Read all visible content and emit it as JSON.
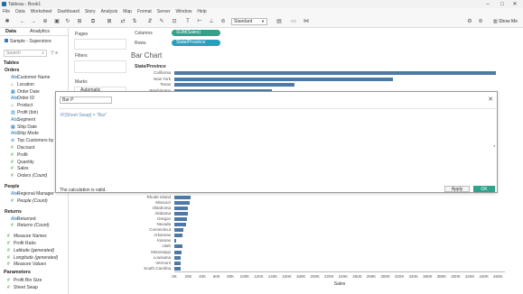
{
  "window": {
    "title": "Tableau - Book1"
  },
  "menu": [
    "File",
    "Data",
    "Worksheet",
    "Dashboard",
    "Story",
    "Analysis",
    "Map",
    "Format",
    "Server",
    "Window",
    "Help"
  ],
  "toolbar": {
    "mark_fit": "Standard",
    "show_me": "Show Me"
  },
  "left": {
    "tabs": [
      "Data",
      "Analytics"
    ],
    "datasource": "Sample - Superstore",
    "search_placeholder": "Search",
    "tables_header": "Tables",
    "groups": [
      {
        "name": "Orders",
        "items": [
          {
            "label": "Customer Name",
            "kind": "dim",
            "icon": "Abc"
          },
          {
            "label": "Location",
            "kind": "dim",
            "icon": "⌂"
          },
          {
            "label": "Order Date",
            "kind": "dim",
            "icon": "▦"
          },
          {
            "label": "Order ID",
            "kind": "dim",
            "icon": "Abc"
          },
          {
            "label": "Product",
            "kind": "dim",
            "icon": "⌂"
          },
          {
            "label": "Profit (bin)",
            "kind": "dim",
            "icon": "▥"
          },
          {
            "label": "Segment",
            "kind": "dim",
            "icon": "Abc"
          },
          {
            "label": "Ship Date",
            "kind": "dim",
            "icon": "▦"
          },
          {
            "label": "Ship Mode",
            "kind": "dim",
            "icon": "Abc"
          },
          {
            "label": "Top Customers by P...",
            "kind": "dim",
            "icon": "⊘"
          },
          {
            "label": "Discount",
            "kind": "mea",
            "icon": "#"
          },
          {
            "label": "Profit",
            "kind": "mea",
            "icon": "#"
          },
          {
            "label": "Quantity",
            "kind": "mea",
            "icon": "#"
          },
          {
            "label": "Sales",
            "kind": "mea",
            "icon": "#"
          },
          {
            "label": "Orders (Count)",
            "kind": "mea",
            "icon": "#",
            "italic": true
          }
        ]
      },
      {
        "name": "People",
        "items": [
          {
            "label": "Regional Manager",
            "kind": "dim",
            "icon": "Abc"
          },
          {
            "label": "People (Count)",
            "kind": "mea",
            "icon": "#",
            "italic": true
          }
        ]
      },
      {
        "name": "Returns",
        "items": [
          {
            "label": "Returned",
            "kind": "dim",
            "icon": "Abc"
          },
          {
            "label": "Returns (Count)",
            "kind": "mea",
            "icon": "#",
            "italic": true
          }
        ]
      }
    ],
    "extra_measures": [
      {
        "label": "Measure Names",
        "italic": true
      },
      {
        "label": "Profit Ratio"
      },
      {
        "label": "Latitude (generated)",
        "italic": true
      },
      {
        "label": "Longitude (generated)",
        "italic": true
      },
      {
        "label": "Measure Values",
        "italic": true
      }
    ],
    "parameters_header": "Parameters",
    "parameters": [
      "Profit Bin Size",
      "Sheet Swap"
    ]
  },
  "shelves": {
    "pages": "Pages",
    "filters": "Filters",
    "marks": "Marks",
    "marks_type": "Automatic"
  },
  "columns": {
    "label": "Columns",
    "pill": "SUM(Sales)"
  },
  "rows": {
    "label": "Rows",
    "pill": "State/Province"
  },
  "view": {
    "sheet_title": "Bar Chart",
    "row_header": "State/Province"
  },
  "dialog": {
    "calc_name": "Bar P",
    "formula_fn": "IF[Sheet Swap] = \"Bar\"",
    "status": "The calculation is valid.",
    "apply": "Apply",
    "ok": "OK"
  },
  "chart_data": {
    "type": "bar",
    "orientation": "horizontal",
    "top": {
      "categories": [
        "California",
        "New York",
        "Texas",
        "Washington"
      ],
      "values": [
        457688,
        310876,
        170188,
        138641
      ]
    },
    "bottom": {
      "categories": [
        "Rhode Island",
        "Missouri",
        "Oklahoma",
        "Alabama",
        "Oregon",
        "Nevada",
        "Connecticut",
        "Arkansas",
        "Kansas",
        "Utah",
        "Mississippi",
        "Louisiana",
        "Vermont",
        "South Carolina"
      ],
      "values": [
        22628,
        22205,
        19683,
        19511,
        17431,
        16729,
        13384,
        11678,
        2914,
        11220,
        10771,
        9217,
        8929,
        8482
      ]
    },
    "xlabel": "Sales",
    "xticks": [
      "0K",
      "20K",
      "40K",
      "60K",
      "80K",
      "100K",
      "120K",
      "140K",
      "160K",
      "180K",
      "200K",
      "220K",
      "240K",
      "260K",
      "280K",
      "300K",
      "320K",
      "340K",
      "360K",
      "380K",
      "400K",
      "420K",
      "440K",
      "460K"
    ],
    "xlim": [
      0,
      470000
    ],
    "color": "#4e79a7"
  }
}
